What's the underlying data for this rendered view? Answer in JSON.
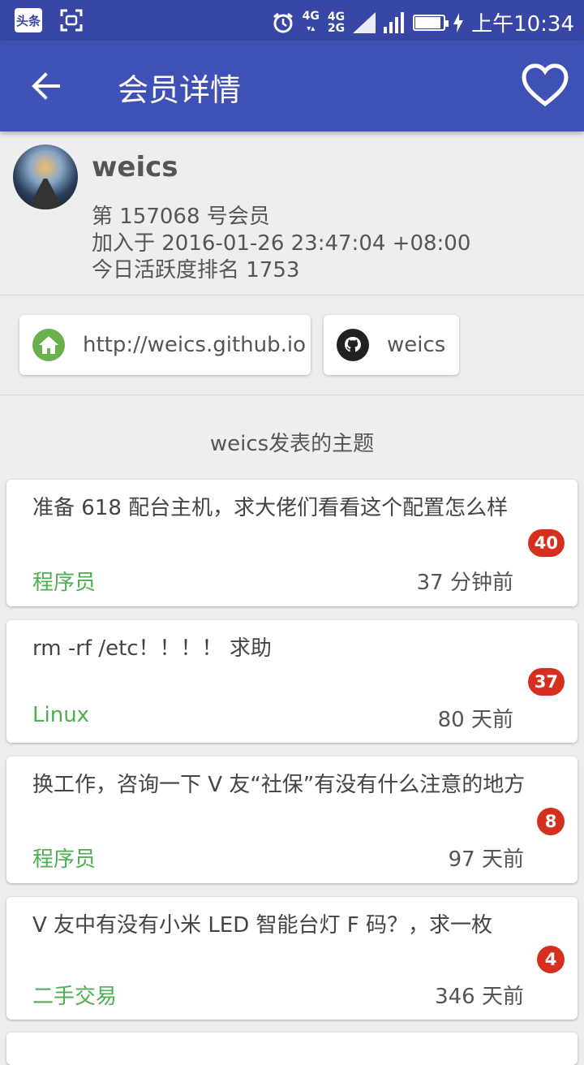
{
  "status_bar": {
    "app_badge": "头条",
    "net1": "4G",
    "net2": "4G",
    "net3": "2G",
    "time": "上午10:34",
    "battery_level": 0.85
  },
  "app_bar": {
    "title": "会员详情"
  },
  "profile": {
    "username": "weics",
    "member_no": "第 157068 号会员",
    "joined": "加入于 2016-01-26 23:47:04 +08:00",
    "rank": "今日活跃度排名 1753"
  },
  "links": [
    {
      "icon": "home-icon",
      "label": "http://weics.github.io",
      "color": "#6ab04c"
    },
    {
      "icon": "github-icon",
      "label": "weics",
      "color": "#222222"
    }
  ],
  "topics_title": "weics发表的主题",
  "topics": [
    {
      "title": "准备 618 配台主机，求大佬们看看这个配置怎么样",
      "node": "程序员",
      "time": "37 分钟前",
      "replies": "40"
    },
    {
      "title": "rm -rf /etc！！！！ 求助",
      "node": "Linux",
      "time": "80 天前",
      "replies": "37"
    },
    {
      "title": "换工作，咨询一下 V 友“社保”有没有什么注意的地方",
      "node": "程序员",
      "time": "97 天前",
      "replies": "8"
    },
    {
      "title": "V 友中有没有小米 LED 智能台灯 F 码？，求一枚",
      "node": "二手交易",
      "time": "346 天前",
      "replies": "4"
    }
  ],
  "colors": {
    "primary": "#3f51b5",
    "primary_dark": "#3847a6",
    "node_green": "#4caf50",
    "badge_red": "#d62f1f"
  }
}
